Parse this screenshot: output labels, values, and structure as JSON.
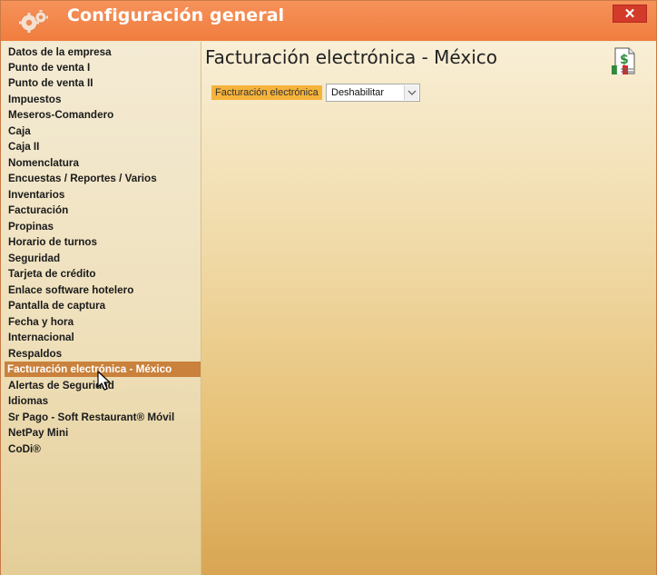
{
  "window": {
    "title": "Configuración general",
    "close_label": "✕"
  },
  "sidebar": {
    "selected_index": 20,
    "items": [
      {
        "label": "Datos de la empresa"
      },
      {
        "label": "Punto de venta I"
      },
      {
        "label": "Punto de venta II"
      },
      {
        "label": "Impuestos"
      },
      {
        "label": "Meseros-Comandero"
      },
      {
        "label": "Caja"
      },
      {
        "label": "Caja II"
      },
      {
        "label": "Nomenclatura"
      },
      {
        "label": "Encuestas / Reportes / Varios"
      },
      {
        "label": "Inventarios"
      },
      {
        "label": "Facturación"
      },
      {
        "label": "Propinas"
      },
      {
        "label": "Horario de turnos"
      },
      {
        "label": "Seguridad"
      },
      {
        "label": "Tarjeta de crédito"
      },
      {
        "label": "Enlace software hotelero"
      },
      {
        "label": "Pantalla de captura"
      },
      {
        "label": "Fecha y hora"
      },
      {
        "label": "Internacional"
      },
      {
        "label": "Respaldos"
      },
      {
        "label": "Facturación electrónica - México"
      },
      {
        "label": "Alertas de Seguridad"
      },
      {
        "label": "Idiomas"
      },
      {
        "label": "Sr Pago - Soft Restaurant® Móvil"
      },
      {
        "label": "NetPay Mini"
      },
      {
        "label": "CoDi®"
      }
    ]
  },
  "main": {
    "title": "Facturación electrónica - México",
    "field": {
      "label": "Facturación electrónica",
      "value": "Deshabilitar"
    }
  },
  "colors": {
    "titlebar": "#f07d3e",
    "selected": "#c9813b",
    "label_highlight": "#f6b33a"
  },
  "icons": {
    "app": "gears-icon",
    "document": "mexico-invoice-icon",
    "close": "close-icon",
    "dropdown": "chevron-down-icon",
    "cursor": "mouse-cursor-icon"
  }
}
